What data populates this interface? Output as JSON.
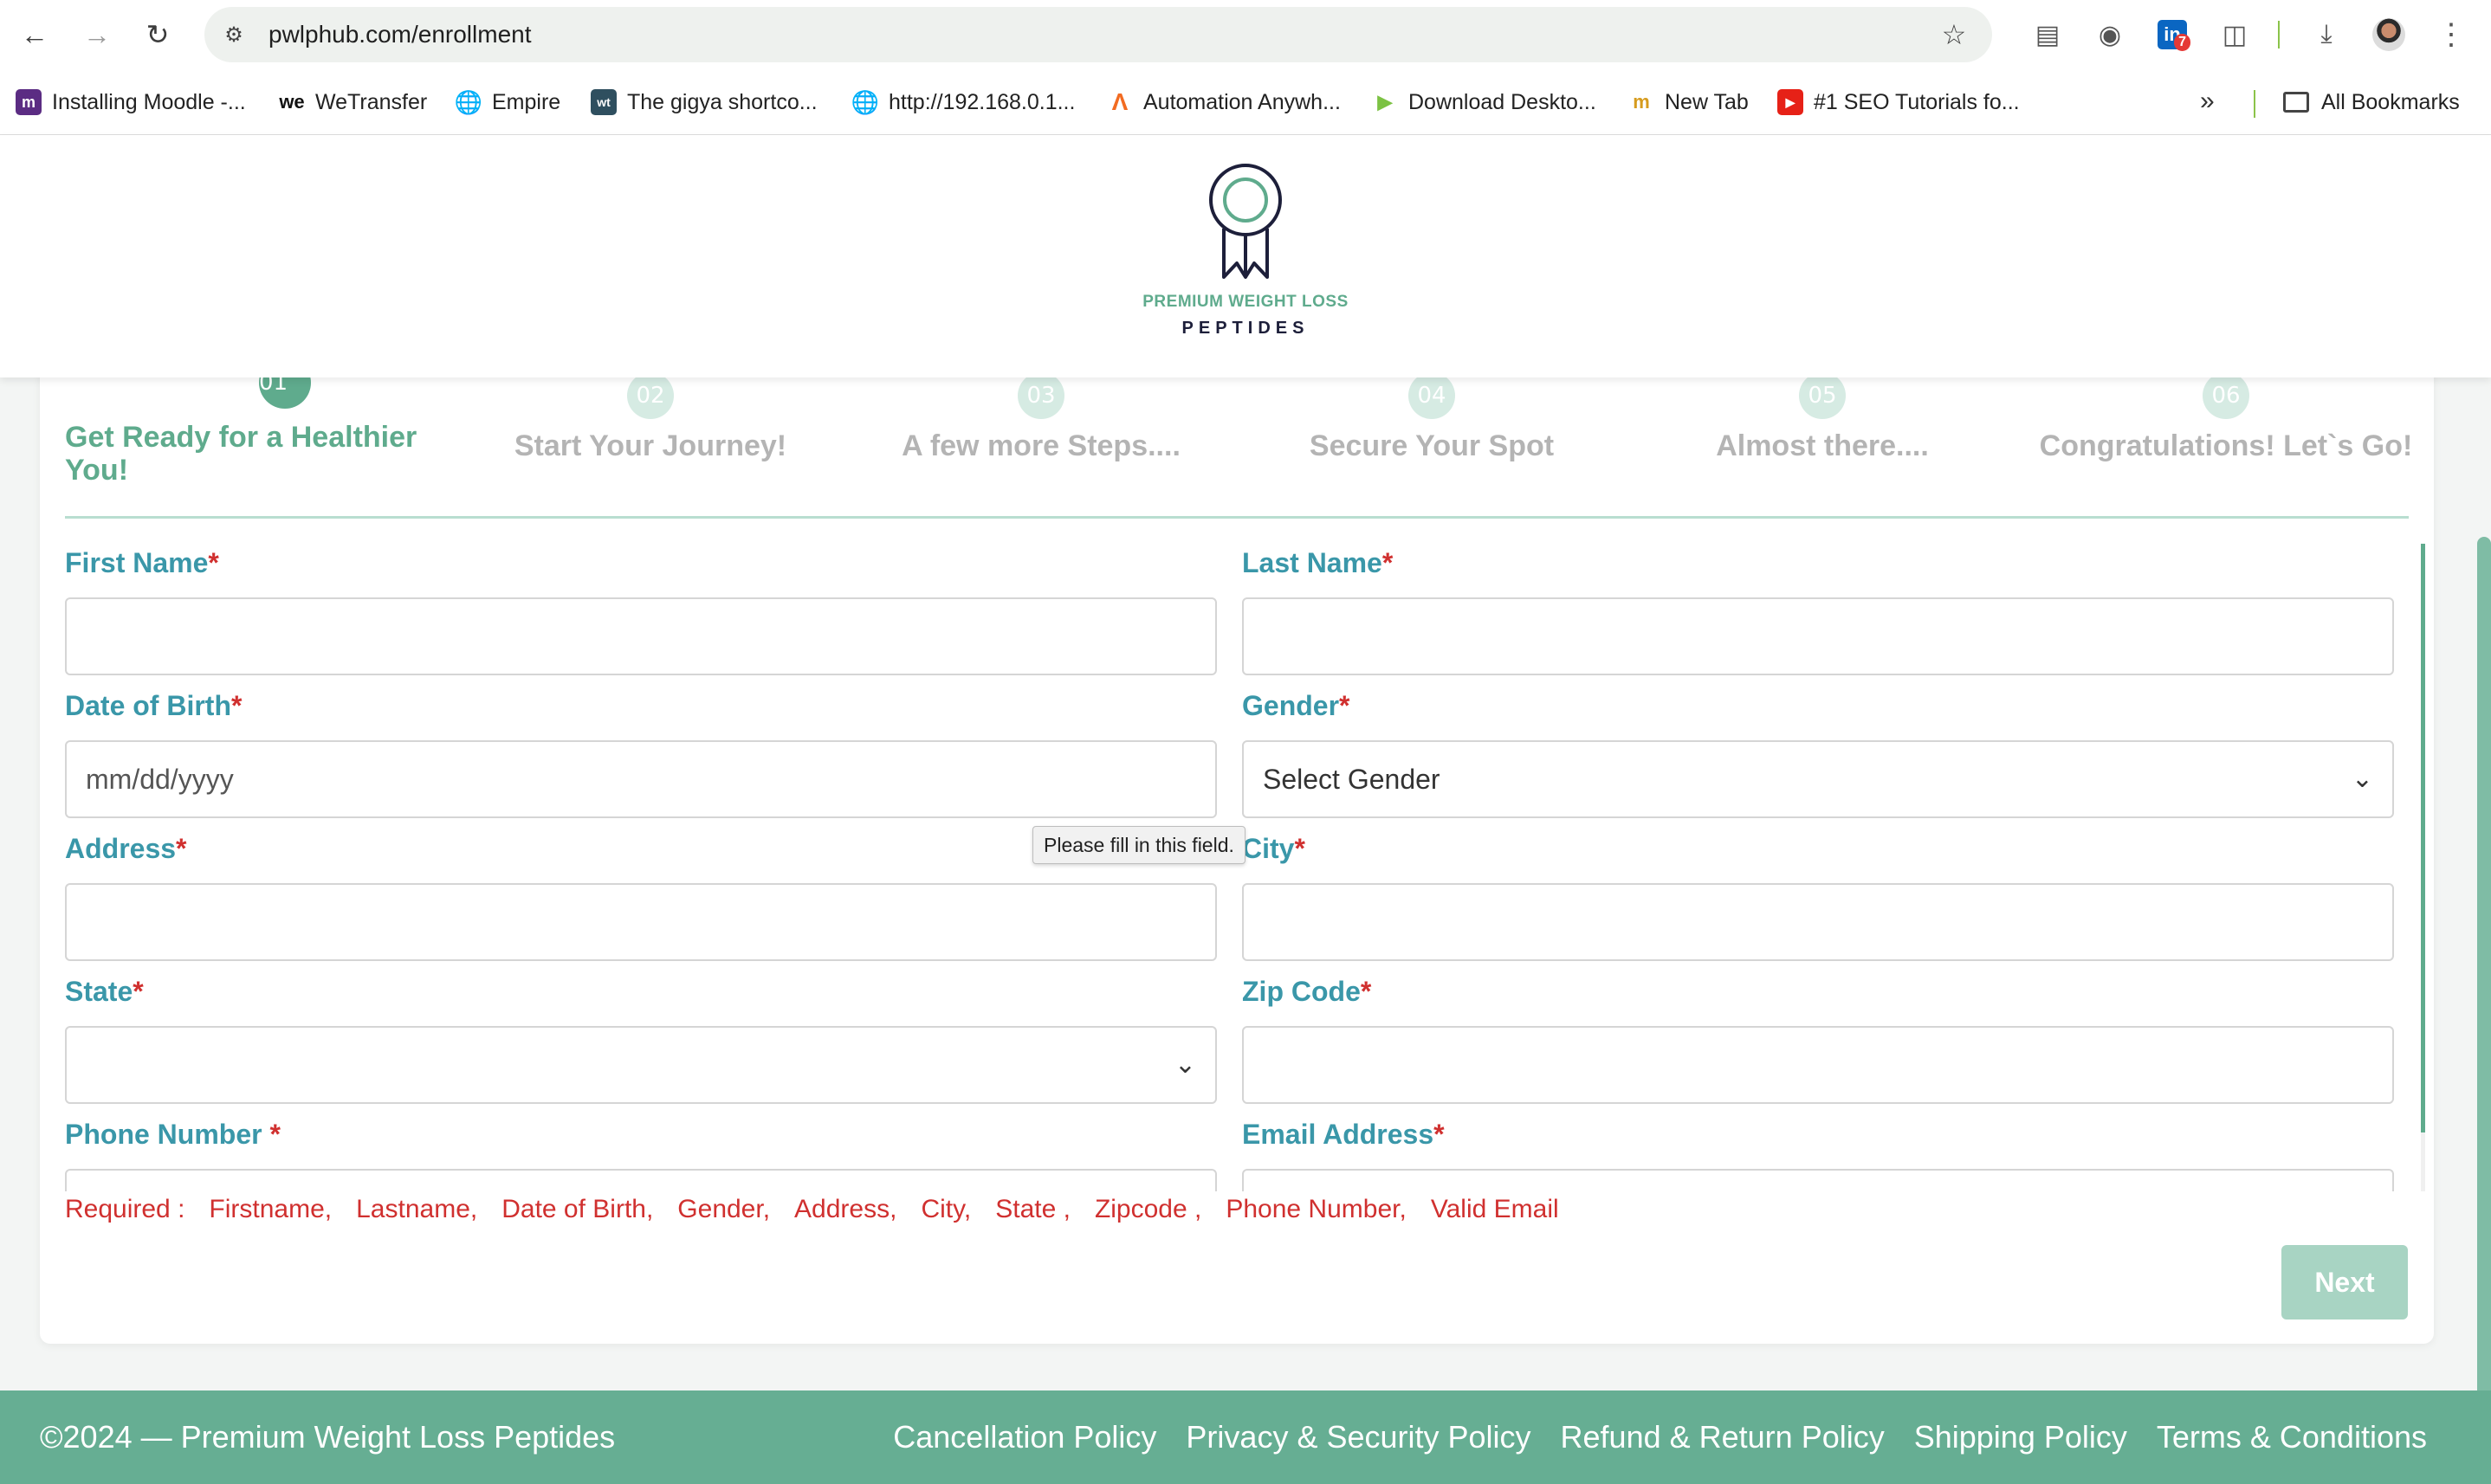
{
  "browser": {
    "url": "pwlphub.com/enrollment",
    "extension_badge": "7",
    "bookmarks": [
      {
        "label": "Installing Moodle -...",
        "icon": "moodle-icon"
      },
      {
        "label": "WeTransfer",
        "icon": "wetransfer-icon"
      },
      {
        "label": "Empire",
        "icon": "globe-icon"
      },
      {
        "label": "The gigya shortco...",
        "icon": "wt-icon"
      },
      {
        "label": "http://192.168.0.1...",
        "icon": "globe-icon"
      },
      {
        "label": "Automation Anywh...",
        "icon": "automation-anywhere-icon"
      },
      {
        "label": "Download Deskto...",
        "icon": "play-icon"
      },
      {
        "label": "New Tab",
        "icon": "newtab-icon"
      },
      {
        "label": "#1 SEO Tutorials fo...",
        "icon": "youtube-icon"
      }
    ],
    "all_bookmarks_label": "All Bookmarks"
  },
  "header": {
    "logo_line1": "PREMIUM WEIGHT LOSS",
    "logo_line2": "PEPTIDES"
  },
  "steps": [
    {
      "num": "01",
      "label": "Get Ready for a Healthier You!",
      "active": true
    },
    {
      "num": "02",
      "label": "Start Your Journey!"
    },
    {
      "num": "03",
      "label": "A few more Steps...."
    },
    {
      "num": "04",
      "label": "Secure Your Spot"
    },
    {
      "num": "05",
      "label": "Almost there...."
    },
    {
      "num": "06",
      "label": "Congratulations! Let`s Go!"
    }
  ],
  "form": {
    "first_name": {
      "label": "First Name",
      "value": ""
    },
    "last_name": {
      "label": "Last Name",
      "value": ""
    },
    "dob": {
      "label": "Date of Birth",
      "placeholder": "mm/dd/yyyy"
    },
    "gender": {
      "label": "Gender",
      "selected": "Select Gender"
    },
    "address": {
      "label": "Address",
      "value": ""
    },
    "city": {
      "label": "City",
      "value": ""
    },
    "state": {
      "label": "State",
      "selected": ""
    },
    "zip": {
      "label": "Zip Code",
      "value": ""
    },
    "phone": {
      "label": "Phone Number ",
      "value": ""
    },
    "email": {
      "label": "Email Address",
      "value": ""
    },
    "required_marker": "*"
  },
  "tooltip": "Please fill in this field.",
  "required_list": {
    "prefix": "Required :",
    "items": [
      "Firstname,",
      "Lastname,",
      "Date of Birth,",
      "Gender,",
      "Address,",
      "City,",
      "State ,",
      "Zipcode ,",
      "Phone Number,",
      "Valid Email"
    ]
  },
  "next_label": "Next",
  "footer": {
    "copyright": "©2024 — Premium Weight Loss Peptides",
    "links": [
      "Cancellation Policy",
      "Privacy & Security Policy",
      "Refund & Return Policy",
      "Shipping Policy",
      "Terms & Conditions"
    ]
  },
  "colors": {
    "brand_green": "#5fab8d",
    "label_teal": "#3a97a9",
    "required_red": "#d0302f",
    "footer_bg": "#66ae93"
  }
}
